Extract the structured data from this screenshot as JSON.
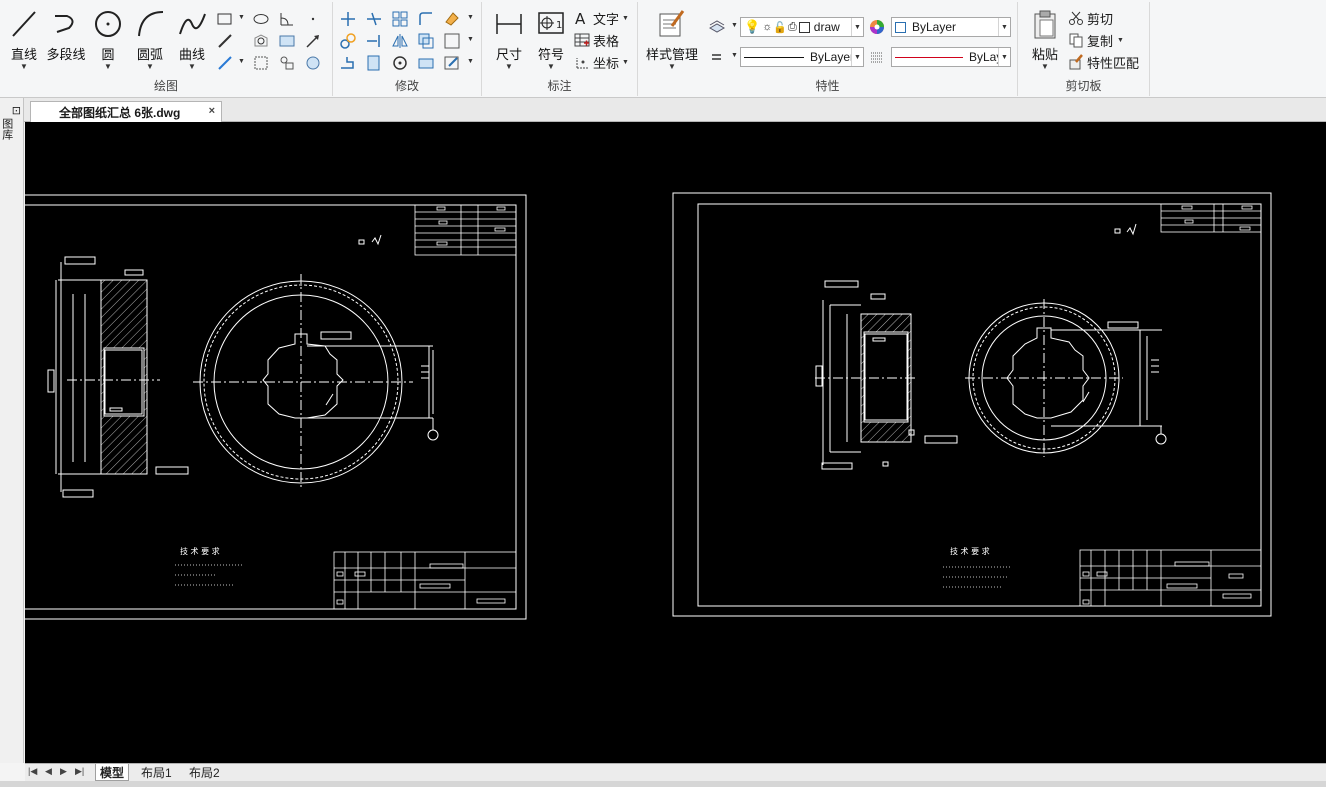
{
  "document": {
    "tab_title": "全部图纸汇总 6张.dwg",
    "close_glyph": "×"
  },
  "side_panel": {
    "label": "图库"
  },
  "ribbon": {
    "draw": {
      "label": "绘图",
      "line": "直线",
      "polyline": "多段线",
      "circle": "圆",
      "arc": "圆弧",
      "curve": "曲线"
    },
    "modify": {
      "label": "修改"
    },
    "annotate": {
      "label": "标注",
      "dimension": "尺寸",
      "symbol": "符号",
      "text": "文字",
      "table": "表格",
      "coordinate": "坐标"
    },
    "properties": {
      "label": "特性",
      "style_manager": "样式管理",
      "layer_value": "draw",
      "color_value": "ByLayer",
      "linetype_value": "ByLayer",
      "lineweight_value": "ByLaye"
    },
    "clipboard": {
      "label": "剪切板",
      "paste": "粘贴",
      "cut": "剪切",
      "copy": "复制",
      "match_prop": "特性匹配"
    }
  },
  "drawing": {
    "tech_req_title": "技 术 要 求"
  },
  "layouts": {
    "tabs": [
      "模型",
      "布局1",
      "布局2"
    ],
    "active": "模型"
  },
  "colors": {
    "canvas_bg": "#000000",
    "line": "#ffffff",
    "lineweight_red": "#d0021b",
    "ribbon_bg": "#f5f6f7"
  }
}
